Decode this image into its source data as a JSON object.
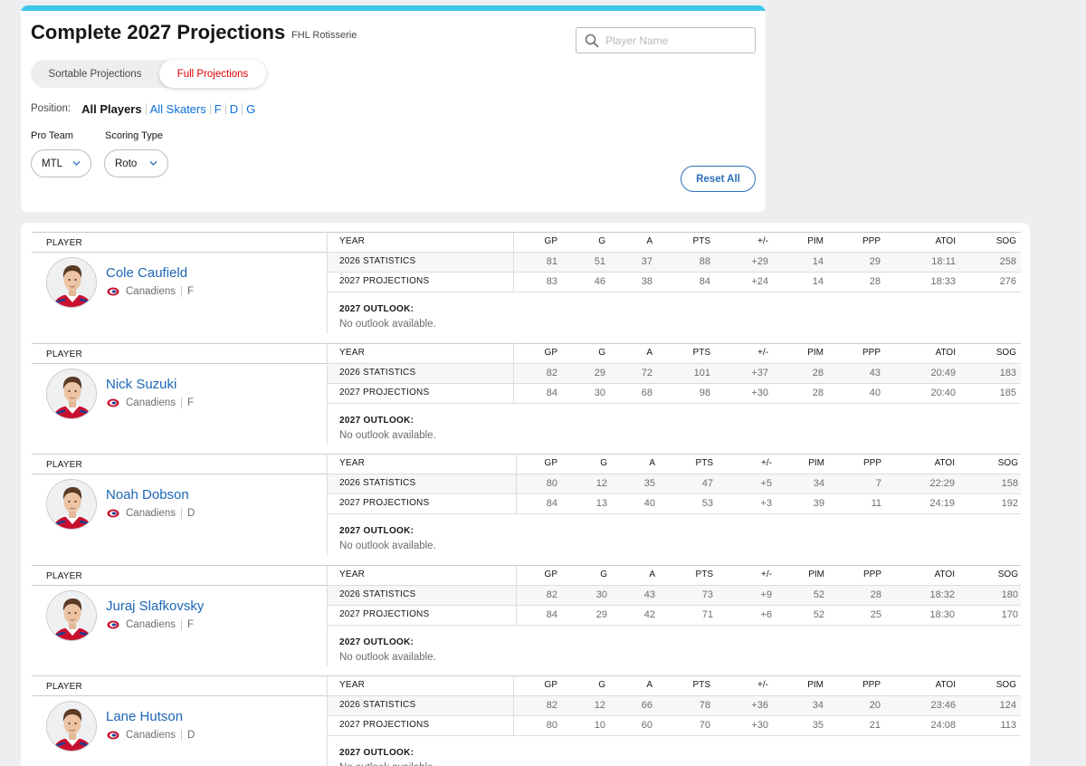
{
  "header": {
    "title": "Complete 2027 Projections",
    "league": "FHL Rotisserie",
    "search_placeholder": "Player Name"
  },
  "view_toggle": {
    "sortable_label": "Sortable Projections",
    "full_label": "Full Projections",
    "selected": "Full Projections"
  },
  "position_filter": {
    "label": "Position:",
    "options": [
      "All Players",
      "All Skaters",
      "F",
      "D",
      "G"
    ],
    "selected": "All Players"
  },
  "filters": {
    "pro_team_label": "Pro Team",
    "pro_team_value": "MTL",
    "scoring_label": "Scoring Type",
    "scoring_value": "Roto",
    "reset_label": "Reset All"
  },
  "columns": {
    "player": "PLAYER",
    "year": "YEAR",
    "stats": [
      "GP",
      "G",
      "A",
      "PTS",
      "+/-",
      "PIM",
      "PPP",
      "ATOI",
      "SOG"
    ]
  },
  "outlook_title": "2027 OUTLOOK:",
  "players": [
    {
      "name": "Cole Caufield",
      "team": "Canadiens",
      "position": "F",
      "rows": [
        {
          "label": "2026 STATISTICS",
          "values": [
            "81",
            "51",
            "37",
            "88",
            "+29",
            "14",
            "29",
            "18:11",
            "258"
          ]
        },
        {
          "label": "2027 PROJECTIONS",
          "values": [
            "83",
            "46",
            "38",
            "84",
            "+24",
            "14",
            "28",
            "18:33",
            "276"
          ]
        }
      ],
      "outlook": "No outlook available."
    },
    {
      "name": "Nick Suzuki",
      "team": "Canadiens",
      "position": "F",
      "rows": [
        {
          "label": "2026 STATISTICS",
          "values": [
            "82",
            "29",
            "72",
            "101",
            "+37",
            "28",
            "43",
            "20:49",
            "183"
          ]
        },
        {
          "label": "2027 PROJECTIONS",
          "values": [
            "84",
            "30",
            "68",
            "98",
            "+30",
            "28",
            "40",
            "20:40",
            "185"
          ]
        }
      ],
      "outlook": "No outlook available."
    },
    {
      "name": "Noah Dobson",
      "team": "Canadiens",
      "position": "D",
      "rows": [
        {
          "label": "2026 STATISTICS",
          "values": [
            "80",
            "12",
            "35",
            "47",
            "+5",
            "34",
            "7",
            "22:29",
            "158"
          ]
        },
        {
          "label": "2027 PROJECTIONS",
          "values": [
            "84",
            "13",
            "40",
            "53",
            "+3",
            "39",
            "11",
            "24:19",
            "192"
          ]
        }
      ],
      "outlook": "No outlook available."
    },
    {
      "name": "Juraj Slafkovsky",
      "team": "Canadiens",
      "position": "F",
      "rows": [
        {
          "label": "2026 STATISTICS",
          "values": [
            "82",
            "30",
            "43",
            "73",
            "+9",
            "52",
            "28",
            "18:32",
            "180"
          ]
        },
        {
          "label": "2027 PROJECTIONS",
          "values": [
            "84",
            "29",
            "42",
            "71",
            "+6",
            "52",
            "25",
            "18:30",
            "170"
          ]
        }
      ],
      "outlook": "No outlook available."
    },
    {
      "name": "Lane Hutson",
      "team": "Canadiens",
      "position": "D",
      "rows": [
        {
          "label": "2026 STATISTICS",
          "values": [
            "82",
            "12",
            "66",
            "78",
            "+36",
            "34",
            "20",
            "23:46",
            "124"
          ]
        },
        {
          "label": "2027 PROJECTIONS",
          "values": [
            "80",
            "10",
            "60",
            "70",
            "+30",
            "35",
            "21",
            "24:08",
            "113"
          ]
        }
      ],
      "outlook": "No outlook available."
    }
  ],
  "colors": {
    "accent_bar": "#3dc7e8",
    "link": "#1c66b6",
    "active_toggle_text": "#dd0000",
    "jersey_red": "#c8102e",
    "jersey_blue": "#1c3f94"
  },
  "icons": [
    "search-icon",
    "chevron-down-icon",
    "canadiens-logo-icon",
    "player-headshot"
  ]
}
